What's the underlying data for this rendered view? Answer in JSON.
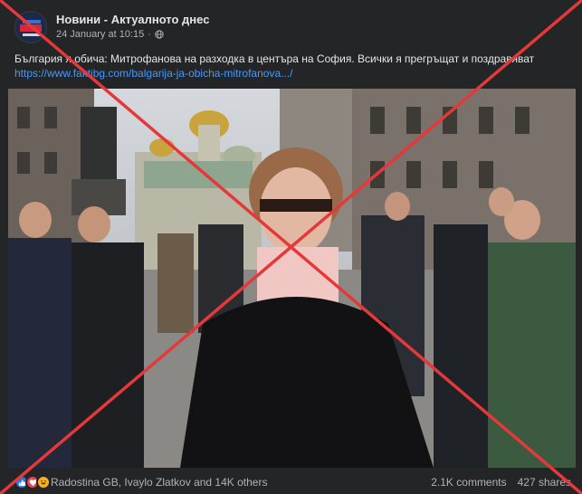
{
  "post": {
    "page_name": "Новини - Актуалното днес",
    "timestamp": "24 January at 10:15",
    "separator": "·",
    "audience_icon": "globe-icon",
    "caption": "България я обича: Митрофанова на разходка в центъра на София. Всички я прегръщат и поздравяват",
    "link": "https://www.faktibg.com/balgarija-ja-obicha-mitrofanova.../"
  },
  "footer": {
    "reactions_text": "Radostina GB, Ivaylo Zlatkov and 14K others",
    "comments": "2.1K comments",
    "shares": "427 shares"
  },
  "overlay": {
    "type": "red-x-cross",
    "color": "#e5383b"
  },
  "colors": {
    "background": "#242526",
    "text": "#e4e6eb",
    "secondary_text": "#b0b3b8",
    "link": "#4599ff",
    "like": "#2078f4",
    "love": "#f33e58",
    "haha": "#f7b125"
  }
}
